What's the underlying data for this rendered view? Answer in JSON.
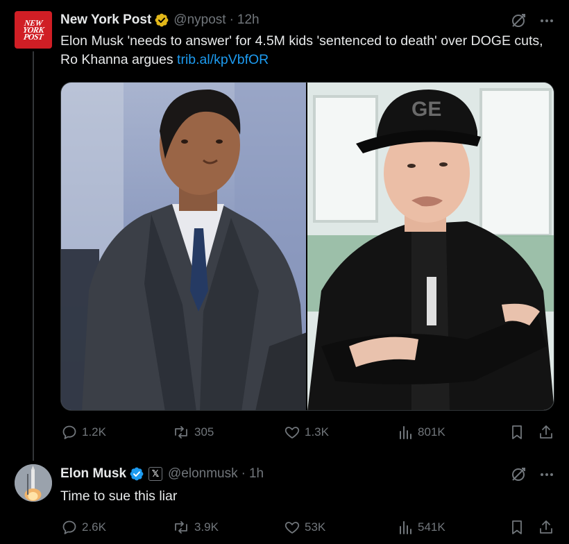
{
  "tweets": [
    {
      "author": "New York Post",
      "handle": "@nypost",
      "separator": "·",
      "time": "12h",
      "avatar_text": [
        "NEW",
        "YORK",
        "POST"
      ],
      "text": "Elon Musk 'needs to answer' for 4.5M kids 'sentenced to death' over DOGE cuts, Ro Khanna argues ",
      "link": "trib.al/kpVbfOR",
      "badge": "gold-verified-icon",
      "stats": {
        "replies": "1.2K",
        "reposts": "305",
        "likes": "1.3K",
        "views": "801K"
      }
    },
    {
      "author": "Elon Musk",
      "handle": "@elonmusk",
      "separator": "·",
      "time": "1h",
      "affiliation_badge": "𝕏",
      "text": "Time to sue this liar",
      "badge": "blue-verified-icon",
      "stats": {
        "replies": "2.6K",
        "reposts": "3.9K",
        "likes": "53K",
        "views": "541K"
      }
    }
  ],
  "colors": {
    "background": "#000000",
    "text": "#e7e9ea",
    "muted": "#71767b",
    "link": "#1d9bf0",
    "gold": "#e2b719",
    "blue": "#1d9bf0",
    "nyp_red": "#d01e25"
  },
  "images": {
    "cap_text": "GE"
  }
}
